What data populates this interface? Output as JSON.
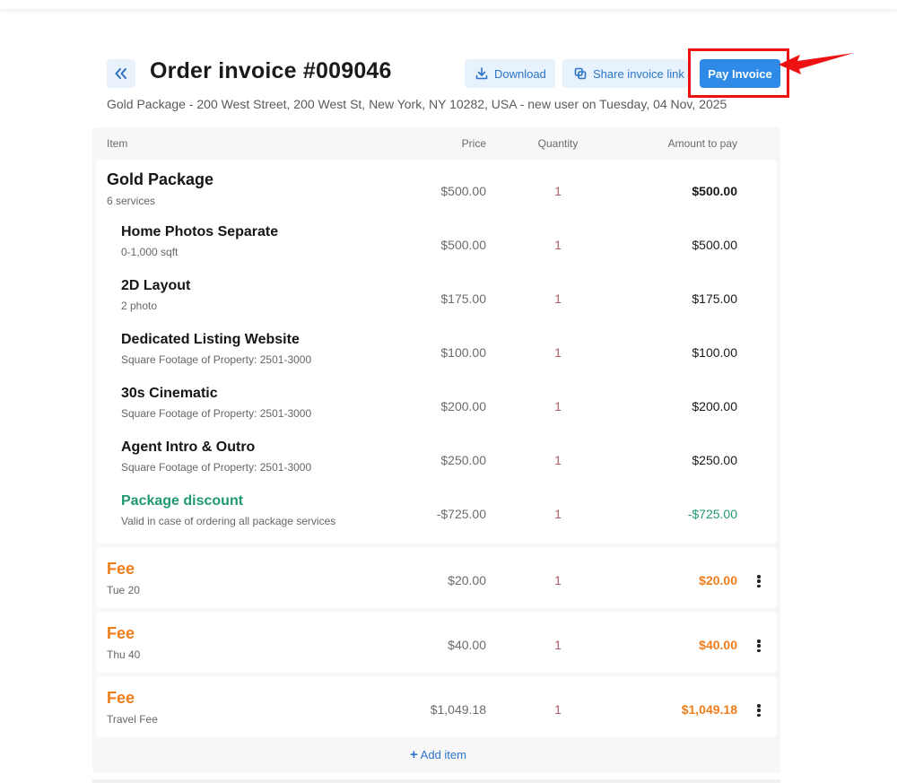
{
  "header": {
    "title": "Order invoice #009046",
    "subtitle": "Gold Package - 200 West Street, 200 West St, New York, NY 10282, USA - new user on Tuesday, 04 Nov, 2025",
    "download_label": "Download",
    "share_label": "Share invoice link",
    "pay_label": "Pay Invoice"
  },
  "columns": {
    "item": "Item",
    "price": "Price",
    "quantity": "Quantity",
    "amount": "Amount to pay"
  },
  "package": {
    "name": "Gold Package",
    "desc": "6 services",
    "price": "$500.00",
    "qty": "1",
    "amount": "$500.00",
    "services": [
      {
        "name": "Home Photos Separate",
        "desc": "0-1,000 sqft",
        "price": "$500.00",
        "qty": "1",
        "amount": "$500.00"
      },
      {
        "name": "2D Layout",
        "desc": "2 photo",
        "price": "$175.00",
        "qty": "1",
        "amount": "$175.00"
      },
      {
        "name": "Dedicated Listing Website",
        "desc": "Square Footage of Property: 2501-3000",
        "price": "$100.00",
        "qty": "1",
        "amount": "$100.00"
      },
      {
        "name": "30s Cinematic",
        "desc": "Square Footage of Property: 2501-3000",
        "price": "$200.00",
        "qty": "1",
        "amount": "$200.00"
      },
      {
        "name": "Agent Intro & Outro",
        "desc": "Square Footage of Property: 2501-3000",
        "price": "$250.00",
        "qty": "1",
        "amount": "$250.00"
      },
      {
        "name": "Package discount",
        "desc": "Valid in case of ordering all package services",
        "price": "-$725.00",
        "qty": "1",
        "amount": "-$725.00"
      }
    ]
  },
  "fees": [
    {
      "name": "Fee",
      "desc": "Tue 20",
      "price": "$20.00",
      "qty": "1",
      "amount": "$20.00"
    },
    {
      "name": "Fee",
      "desc": "Thu 40",
      "price": "$40.00",
      "qty": "1",
      "amount": "$40.00"
    },
    {
      "name": "Fee",
      "desc": "Travel Fee",
      "price": "$1,049.18",
      "qty": "1",
      "amount": "$1,049.18"
    }
  ],
  "add_item": {
    "icon": "+",
    "label": "Add item"
  },
  "colors": {
    "accent": "#2e8ae6",
    "fee": "#ef7d1a",
    "discount": "#1f9a6e",
    "highlight": "#ee1111"
  },
  "icons": [
    "double-chevron-left-icon",
    "download-icon",
    "copy-link-icon",
    "arrow-pointer-icon",
    "more-vertical-icon",
    "plus-icon"
  ]
}
